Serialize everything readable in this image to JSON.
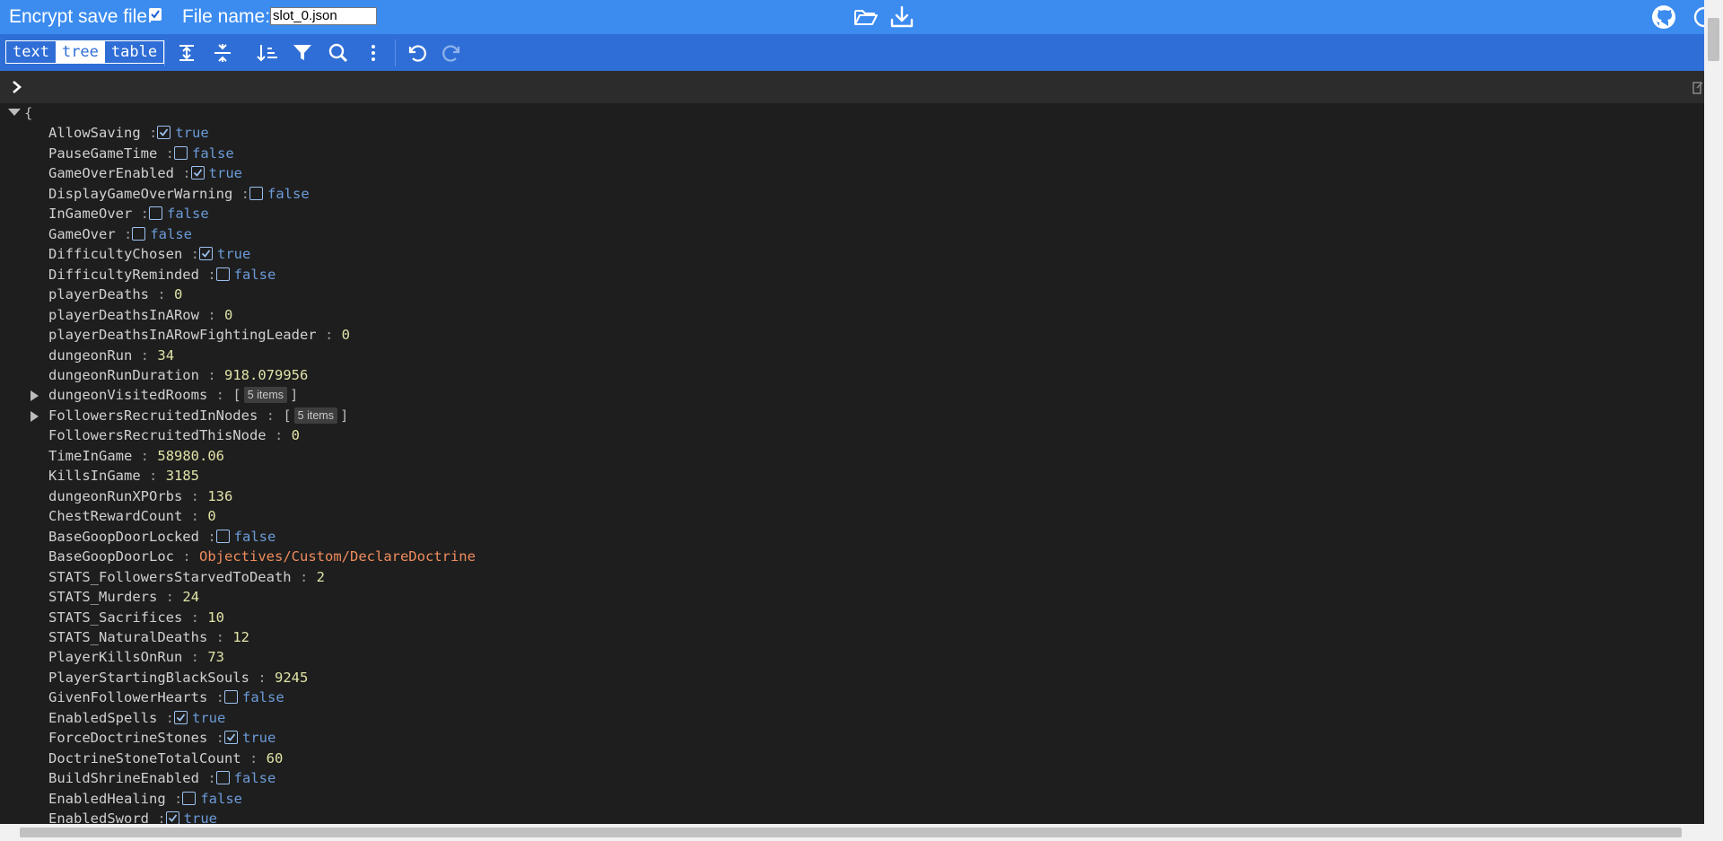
{
  "header": {
    "encrypt_label": "Encrypt save file:",
    "encrypt_checked": true,
    "filename_label": "File name:",
    "filename_value": "slot_0.json",
    "icons": [
      "folder-open-icon",
      "download-icon",
      "github-icon",
      "theme-toggle-icon"
    ]
  },
  "toolbar": {
    "modes": [
      "text",
      "tree",
      "table"
    ],
    "active_mode": "tree",
    "buttons": [
      "expand-all-icon",
      "collapse-all-icon",
      "sort-icon",
      "filter-icon",
      "search-icon",
      "more-icon",
      "undo-icon",
      "redo-icon"
    ]
  },
  "tree": {
    "open_brace": "{",
    "separator": ":",
    "rows": [
      {
        "key": "AllowSaving",
        "type": "bool",
        "value": "true"
      },
      {
        "key": "PauseGameTime",
        "type": "bool",
        "value": "false"
      },
      {
        "key": "GameOverEnabled",
        "type": "bool",
        "value": "true"
      },
      {
        "key": "DisplayGameOverWarning",
        "type": "bool",
        "value": "false"
      },
      {
        "key": "InGameOver",
        "type": "bool",
        "value": "false"
      },
      {
        "key": "GameOver",
        "type": "bool",
        "value": "false"
      },
      {
        "key": "DifficultyChosen",
        "type": "bool",
        "value": "true"
      },
      {
        "key": "DifficultyReminded",
        "type": "bool",
        "value": "false"
      },
      {
        "key": "playerDeaths",
        "type": "num",
        "value": "0"
      },
      {
        "key": "playerDeathsInARow",
        "type": "num",
        "value": "0"
      },
      {
        "key": "playerDeathsInARowFightingLeader",
        "type": "num",
        "value": "0"
      },
      {
        "key": "dungeonRun",
        "type": "num",
        "value": "34"
      },
      {
        "key": "dungeonRunDuration",
        "type": "num",
        "value": "918.079956"
      },
      {
        "key": "dungeonVisitedRooms",
        "type": "array",
        "value": "5 items",
        "open": "[",
        "close": "]"
      },
      {
        "key": "FollowersRecruitedInNodes",
        "type": "array",
        "value": "5 items",
        "open": "[",
        "close": "]"
      },
      {
        "key": "FollowersRecruitedThisNode",
        "type": "num",
        "value": "0"
      },
      {
        "key": "TimeInGame",
        "type": "num",
        "value": "58980.06"
      },
      {
        "key": "KillsInGame",
        "type": "num",
        "value": "3185"
      },
      {
        "key": "dungeonRunXPOrbs",
        "type": "num",
        "value": "136"
      },
      {
        "key": "ChestRewardCount",
        "type": "num",
        "value": "0"
      },
      {
        "key": "BaseGoopDoorLocked",
        "type": "bool",
        "value": "false"
      },
      {
        "key": "BaseGoopDoorLoc",
        "type": "str",
        "value": "Objectives/Custom/DeclareDoctrine"
      },
      {
        "key": "STATS_FollowersStarvedToDeath",
        "type": "num",
        "value": "2"
      },
      {
        "key": "STATS_Murders",
        "type": "num",
        "value": "24"
      },
      {
        "key": "STATS_Sacrifices",
        "type": "num",
        "value": "10"
      },
      {
        "key": "STATS_NaturalDeaths",
        "type": "num",
        "value": "12"
      },
      {
        "key": "PlayerKillsOnRun",
        "type": "num",
        "value": "73"
      },
      {
        "key": "PlayerStartingBlackSouls",
        "type": "num",
        "value": "9245"
      },
      {
        "key": "GivenFollowerHearts",
        "type": "bool",
        "value": "false"
      },
      {
        "key": "EnabledSpells",
        "type": "bool",
        "value": "true"
      },
      {
        "key": "ForceDoctrineStones",
        "type": "bool",
        "value": "true"
      },
      {
        "key": "DoctrineStoneTotalCount",
        "type": "num",
        "value": "60"
      },
      {
        "key": "BuildShrineEnabled",
        "type": "bool",
        "value": "false"
      },
      {
        "key": "EnabledHealing",
        "type": "bool",
        "value": "false"
      },
      {
        "key": "EnabledSword",
        "type": "bool",
        "value": "true"
      }
    ]
  }
}
